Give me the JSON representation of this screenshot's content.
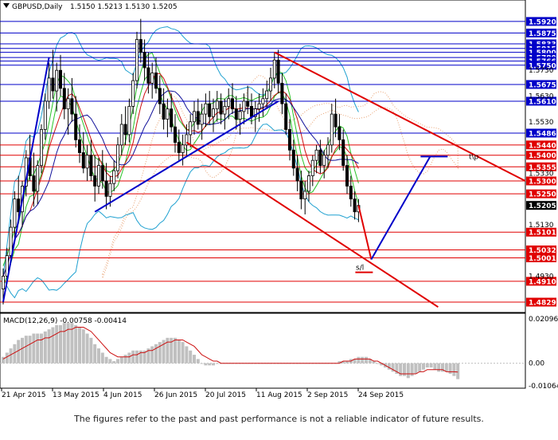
{
  "header": {
    "symbol_label": "GBPUSD,Daily",
    "ohlc": "1.5150 1.5213 1.5130 1.5205"
  },
  "disclaimer": "The figures refer to the past and past performance is not a reliable indicator of future results.",
  "colors": {
    "price_line": "#0000c8",
    "support_line": "#e00000",
    "candle": "#000000",
    "bollinger": "#1ea0d0",
    "envelope_green": "#27c427",
    "ma_red": "#cc1010",
    "ma_blue": "#10109a",
    "ichimoku_cloud": "#e8a070",
    "macd_hist": "#c0c0c0",
    "macd_signal": "#cc1010",
    "tag_blue": "#0000c8",
    "tag_red": "#e00000",
    "current_tag": "#000000"
  },
  "chart_data": {
    "type": "candlestick",
    "title": "GBPUSD,Daily",
    "ylim": [
      1.4795,
      1.596
    ],
    "x_tick_labels": [
      "21 Apr 2015",
      "13 May 2015",
      "4 Jun 2015",
      "26 Jun 2015",
      "20 Jul 2015",
      "11 Aug 2015",
      "2 Sep 2015",
      "24 Sep 2015"
    ],
    "y_tick_labels": [
      "1.5730",
      "1.5630",
      "1.5530",
      "1.5330",
      "1.5130",
      "1.4930"
    ],
    "current_price": "1.5205",
    "horizontal_levels": [
      {
        "label": "1.5920",
        "value": 1.592,
        "color": "blue"
      },
      {
        "label": "1.5875",
        "value": 1.5875,
        "color": "blue"
      },
      {
        "label": "1.5833",
        "value": 1.5833,
        "color": "blue"
      },
      {
        "label": "1.5815",
        "value": 1.5815,
        "color": "blue"
      },
      {
        "label": "1.5800",
        "value": 1.58,
        "color": "blue"
      },
      {
        "label": "1.5780",
        "value": 1.578,
        "color": "blue"
      },
      {
        "label": "1.5766",
        "value": 1.5766,
        "color": "blue"
      },
      {
        "label": "1.5750",
        "value": 1.575,
        "color": "blue"
      },
      {
        "label": "1.5675",
        "value": 1.5675,
        "color": "blue"
      },
      {
        "label": "1.5610",
        "value": 1.561,
        "color": "blue"
      },
      {
        "label": "1.5486",
        "value": 1.5486,
        "color": "blue"
      },
      {
        "label": "1.5440",
        "value": 1.544,
        "color": "red"
      },
      {
        "label": "1.5400",
        "value": 1.54,
        "color": "red"
      },
      {
        "label": "1.5355",
        "value": 1.5355,
        "color": "red"
      },
      {
        "label": "1.5300",
        "value": 1.53,
        "color": "red"
      },
      {
        "label": "1.5250",
        "value": 1.525,
        "color": "red"
      },
      {
        "label": "1.5101",
        "value": 1.5101,
        "color": "red"
      },
      {
        "label": "1.5032",
        "value": 1.5032,
        "color": "red"
      },
      {
        "label": "1.5001",
        "value": 1.5001,
        "color": "red"
      },
      {
        "label": "1.4910",
        "value": 1.491,
        "color": "red"
      },
      {
        "label": "1.4829",
        "value": 1.4829,
        "color": "red"
      }
    ],
    "annotations": [
      {
        "text": "t\\p",
        "value": 1.5395
      },
      {
        "text": "s/l",
        "value": 1.4945
      }
    ],
    "projection": {
      "from": 1.5205,
      "low": 1.4995,
      "target": 1.5395
    },
    "macd": {
      "title": "MACD(12,26,9) -0.00758 -0.00414",
      "params": "12,26,9",
      "main": -0.00758,
      "signal": -0.00414,
      "ylim": [
        -0.01064,
        0.02096
      ],
      "y_tick_labels": [
        "0.02096",
        "0.00",
        "-0.01064"
      ],
      "histogram": [
        0.003,
        0.005,
        0.007,
        0.009,
        0.011,
        0.012,
        0.013,
        0.013,
        0.014,
        0.014,
        0.014,
        0.015,
        0.016,
        0.017,
        0.018,
        0.018,
        0.019,
        0.019,
        0.019,
        0.018,
        0.017,
        0.016,
        0.014,
        0.012,
        0.009,
        0.007,
        0.005,
        0.003,
        0.002,
        0.001,
        0.002,
        0.003,
        0.004,
        0.005,
        0.006,
        0.006,
        0.006,
        0.006,
        0.007,
        0.008,
        0.009,
        0.01,
        0.011,
        0.012,
        0.012,
        0.012,
        0.011,
        0.01,
        0.008,
        0.006,
        0.004,
        0.002,
        0.0,
        -0.001,
        -0.001,
        -0.001,
        0.0,
        0.0,
        0.0,
        0.0,
        0.0,
        0.0,
        0.0,
        0.0,
        0.0,
        0.0,
        0.0,
        0.0,
        0.0,
        0.0,
        0.0,
        0.0,
        0.0,
        0.0,
        0.0,
        0.0,
        0.0,
        0.0,
        0.0,
        0.0,
        0.0,
        0.0,
        0.0,
        0.0,
        0.0,
        0.0,
        0.0,
        0.0,
        0.001,
        0.001,
        0.001,
        0.002,
        0.002,
        0.003,
        0.003,
        0.003,
        0.002,
        0.001,
        0.0,
        -0.001,
        -0.002,
        -0.003,
        -0.004,
        -0.005,
        -0.006,
        -0.006,
        -0.007,
        -0.006,
        -0.005,
        -0.004,
        -0.003,
        -0.002,
        -0.002,
        -0.003,
        -0.004,
        -0.004,
        -0.004,
        -0.005,
        -0.006,
        -0.0075
      ],
      "signal_values": [
        0.002,
        0.003,
        0.004,
        0.005,
        0.006,
        0.007,
        0.008,
        0.009,
        0.01,
        0.011,
        0.011,
        0.012,
        0.012,
        0.013,
        0.014,
        0.015,
        0.015,
        0.016,
        0.016,
        0.017,
        0.017,
        0.017,
        0.016,
        0.015,
        0.013,
        0.011,
        0.009,
        0.007,
        0.005,
        0.004,
        0.003,
        0.003,
        0.003,
        0.003,
        0.004,
        0.004,
        0.005,
        0.005,
        0.006,
        0.006,
        0.007,
        0.008,
        0.009,
        0.01,
        0.01,
        0.011,
        0.011,
        0.011,
        0.01,
        0.009,
        0.008,
        0.006,
        0.004,
        0.003,
        0.002,
        0.001,
        0.001,
        0.0,
        0.0,
        0.0,
        0.0,
        0.0,
        0.0,
        0.0,
        0.0,
        0.0,
        0.0,
        0.0,
        0.0,
        0.0,
        0.0,
        0.0,
        0.0,
        0.0,
        0.0,
        0.0,
        0.0,
        0.0,
        0.0,
        0.0,
        0.0,
        0.0,
        0.0,
        0.0,
        0.0,
        0.0,
        0.0,
        0.0,
        0.0,
        0.001,
        0.001,
        0.001,
        0.002,
        0.002,
        0.002,
        0.002,
        0.002,
        0.001,
        0.001,
        0.0,
        -0.001,
        -0.002,
        -0.003,
        -0.004,
        -0.005,
        -0.005,
        -0.005,
        -0.005,
        -0.005,
        -0.004,
        -0.004,
        -0.003,
        -0.003,
        -0.003,
        -0.003,
        -0.003,
        -0.004,
        -0.004,
        -0.004,
        -0.00414
      ]
    },
    "candles": [
      [
        1.488,
        1.496,
        1.482,
        1.493
      ],
      [
        1.493,
        1.504,
        1.49,
        1.501
      ],
      [
        1.501,
        1.515,
        1.499,
        1.512
      ],
      [
        1.512,
        1.526,
        1.508,
        1.523
      ],
      [
        1.523,
        1.532,
        1.515,
        1.518
      ],
      [
        1.518,
        1.53,
        1.512,
        1.528
      ],
      [
        1.528,
        1.542,
        1.524,
        1.539
      ],
      [
        1.539,
        1.548,
        1.53,
        1.532
      ],
      [
        1.532,
        1.541,
        1.52,
        1.526
      ],
      [
        1.526,
        1.538,
        1.521,
        1.536
      ],
      [
        1.536,
        1.552,
        1.533,
        1.55
      ],
      [
        1.55,
        1.564,
        1.546,
        1.561
      ],
      [
        1.561,
        1.576,
        1.558,
        1.57
      ],
      [
        1.57,
        1.581,
        1.562,
        1.565
      ],
      [
        1.565,
        1.576,
        1.557,
        1.573
      ],
      [
        1.573,
        1.579,
        1.563,
        1.566
      ],
      [
        1.566,
        1.572,
        1.554,
        1.558
      ],
      [
        1.558,
        1.566,
        1.548,
        1.562
      ],
      [
        1.562,
        1.57,
        1.553,
        1.556
      ],
      [
        1.556,
        1.563,
        1.543,
        1.546
      ],
      [
        1.546,
        1.552,
        1.537,
        1.541
      ],
      [
        1.541,
        1.549,
        1.533,
        1.535
      ],
      [
        1.535,
        1.544,
        1.53,
        1.54
      ],
      [
        1.54,
        1.546,
        1.53,
        1.532
      ],
      [
        1.532,
        1.54,
        1.522,
        1.528
      ],
      [
        1.528,
        1.539,
        1.525,
        1.536
      ],
      [
        1.536,
        1.542,
        1.527,
        1.53
      ],
      [
        1.53,
        1.537,
        1.519,
        1.524
      ],
      [
        1.524,
        1.532,
        1.52,
        1.529
      ],
      [
        1.529,
        1.538,
        1.526,
        1.534
      ],
      [
        1.534,
        1.547,
        1.531,
        1.544
      ],
      [
        1.544,
        1.556,
        1.54,
        1.552
      ],
      [
        1.552,
        1.559,
        1.544,
        1.548
      ],
      [
        1.548,
        1.562,
        1.545,
        1.559
      ],
      [
        1.559,
        1.572,
        1.556,
        1.569
      ],
      [
        1.569,
        1.588,
        1.566,
        1.585
      ],
      [
        1.585,
        1.593,
        1.576,
        1.58
      ],
      [
        1.58,
        1.585,
        1.569,
        1.574
      ],
      [
        1.574,
        1.58,
        1.564,
        1.568
      ],
      [
        1.568,
        1.576,
        1.562,
        1.572
      ],
      [
        1.572,
        1.578,
        1.564,
        1.566
      ],
      [
        1.566,
        1.571,
        1.556,
        1.56
      ],
      [
        1.56,
        1.566,
        1.55,
        1.554
      ],
      [
        1.554,
        1.562,
        1.547,
        1.558
      ],
      [
        1.558,
        1.564,
        1.549,
        1.551
      ],
      [
        1.551,
        1.556,
        1.541,
        1.545
      ],
      [
        1.545,
        1.55,
        1.538,
        1.541
      ],
      [
        1.541,
        1.548,
        1.536,
        1.544
      ],
      [
        1.544,
        1.552,
        1.54,
        1.548
      ],
      [
        1.548,
        1.556,
        1.543,
        1.553
      ],
      [
        1.553,
        1.561,
        1.548,
        1.557
      ],
      [
        1.557,
        1.562,
        1.55,
        1.552
      ],
      [
        1.552,
        1.56,
        1.546,
        1.556
      ],
      [
        1.556,
        1.564,
        1.551,
        1.56
      ],
      [
        1.56,
        1.565,
        1.552,
        1.555
      ],
      [
        1.555,
        1.562,
        1.549,
        1.558
      ],
      [
        1.558,
        1.565,
        1.553,
        1.561
      ],
      [
        1.561,
        1.564,
        1.552,
        1.556
      ],
      [
        1.556,
        1.562,
        1.55,
        1.559
      ],
      [
        1.559,
        1.566,
        1.554,
        1.562
      ],
      [
        1.562,
        1.568,
        1.556,
        1.558
      ],
      [
        1.558,
        1.563,
        1.55,
        1.554
      ],
      [
        1.554,
        1.56,
        1.548,
        1.557
      ],
      [
        1.557,
        1.564,
        1.552,
        1.561
      ],
      [
        1.561,
        1.567,
        1.556,
        1.559
      ],
      [
        1.559,
        1.564,
        1.552,
        1.555
      ],
      [
        1.555,
        1.561,
        1.549,
        1.558
      ],
      [
        1.558,
        1.564,
        1.553,
        1.56
      ],
      [
        1.56,
        1.566,
        1.555,
        1.562
      ],
      [
        1.562,
        1.569,
        1.558,
        1.565
      ],
      [
        1.565,
        1.574,
        1.561,
        1.57
      ],
      [
        1.57,
        1.58,
        1.566,
        1.577
      ],
      [
        1.577,
        1.581,
        1.564,
        1.568
      ],
      [
        1.568,
        1.572,
        1.556,
        1.56
      ],
      [
        1.56,
        1.564,
        1.548,
        1.55
      ],
      [
        1.55,
        1.554,
        1.538,
        1.542
      ],
      [
        1.542,
        1.546,
        1.532,
        1.535
      ],
      [
        1.535,
        1.54,
        1.526,
        1.53
      ],
      [
        1.53,
        1.534,
        1.519,
        1.523
      ],
      [
        1.523,
        1.53,
        1.517,
        1.526
      ],
      [
        1.526,
        1.534,
        1.522,
        1.532
      ],
      [
        1.532,
        1.54,
        1.528,
        1.538
      ],
      [
        1.538,
        1.544,
        1.533,
        1.542
      ],
      [
        1.542,
        1.546,
        1.533,
        1.536
      ],
      [
        1.536,
        1.542,
        1.531,
        1.54
      ],
      [
        1.54,
        1.547,
        1.535,
        1.544
      ],
      [
        1.544,
        1.56,
        1.541,
        1.556
      ],
      [
        1.556,
        1.562,
        1.547,
        1.551
      ],
      [
        1.551,
        1.556,
        1.542,
        1.546
      ],
      [
        1.546,
        1.55,
        1.534,
        1.536
      ],
      [
        1.536,
        1.54,
        1.525,
        1.528
      ],
      [
        1.528,
        1.532,
        1.52,
        1.523
      ],
      [
        1.523,
        1.526,
        1.515,
        1.518
      ],
      [
        1.518,
        1.523,
        1.514,
        1.5205
      ]
    ]
  }
}
